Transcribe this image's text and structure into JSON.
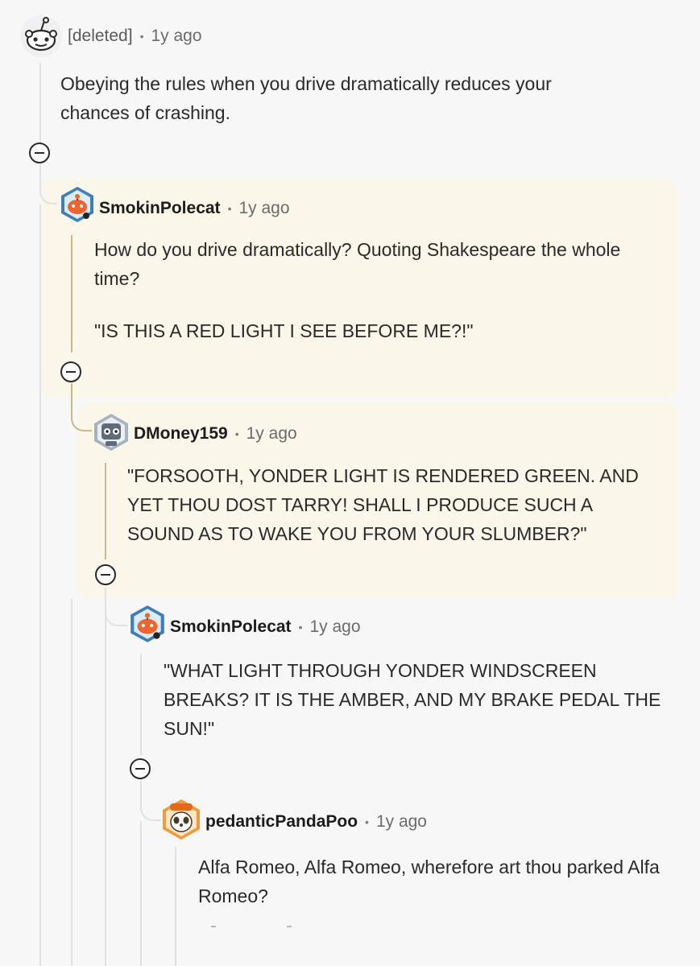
{
  "comments": [
    {
      "username": "[deleted]",
      "age": "1y ago",
      "body": "Obeying the rules when you drive dramatically reduces your chances of crashing."
    },
    {
      "username": "SmokinPolecat",
      "age": "1y ago",
      "body": "How do you drive dramatically? Quoting Shakespeare the whole time?",
      "body2": "\"IS THIS A RED LIGHT I SEE BEFORE ME?!\""
    },
    {
      "username": "DMoney159",
      "age": "1y ago",
      "body": "\"FORSOOTH, YONDER LIGHT IS RENDERED GREEN. AND YET THOU DOST TARRY! SHALL I PRODUCE SUCH A SOUND AS TO WAKE YOU FROM YOUR SLUMBER?\""
    },
    {
      "username": "SmokinPolecat",
      "age": "1y ago",
      "body": "\"WHAT LIGHT THROUGH YONDER WINDSCREEN BREAKS? IT IS THE AMBER, AND MY BRAKE PEDAL THE SUN!\""
    },
    {
      "username": "pedanticPandaPoo",
      "age": "1y ago",
      "body": "Alfa Romeo, Alfa Romeo, wherefore art thou parked Alfa Romeo?"
    }
  ],
  "separator": "•",
  "colors": {
    "highlight": "#fbf6ea",
    "thread_line": "#e1e2e4",
    "highlight_line": "#c9b98a",
    "accent_orange": "#f0652f"
  },
  "icons": [
    "snoo-deleted-avatar",
    "snoo-avatar",
    "robot-avatar",
    "snoo-avatar",
    "panda-avatar",
    "collapse-icon"
  ]
}
